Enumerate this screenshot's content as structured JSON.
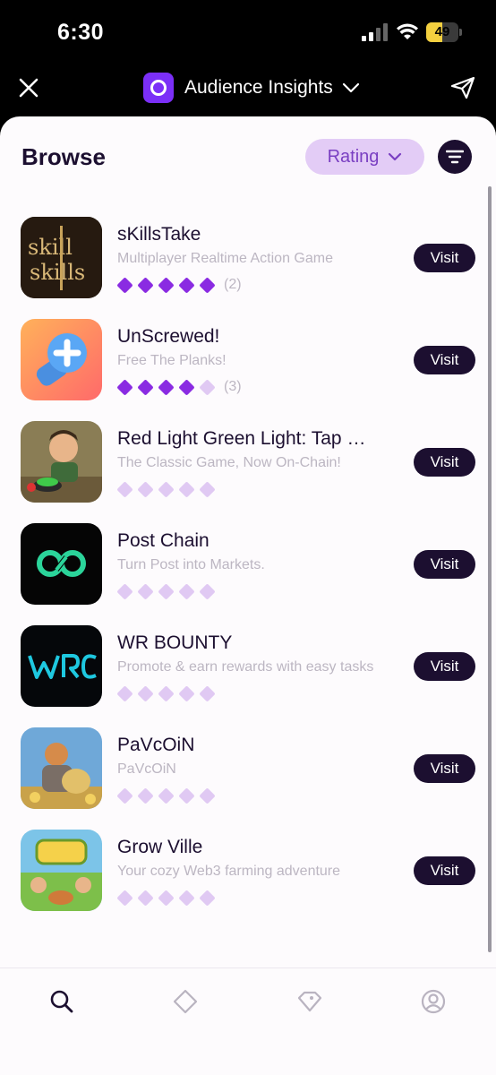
{
  "status_bar": {
    "time": "6:30",
    "battery": "49",
    "battery_level": 0.49
  },
  "header": {
    "title": "Audience Insights"
  },
  "browse": {
    "title": "Browse",
    "sort_label": "Rating"
  },
  "items": [
    {
      "name": "sKillsTake",
      "description": "Multiplayer Realtime Action Game",
      "rating": 5,
      "reviews": "(2)",
      "visit_label": "Visit"
    },
    {
      "name": "UnScrewed!",
      "description": "Free The Planks!",
      "rating": 4,
      "reviews": "(3)",
      "visit_label": "Visit"
    },
    {
      "name": "Red Light Green Light: Tap …",
      "description": "The Classic Game, Now On-Chain!",
      "rating": 0,
      "reviews": "",
      "visit_label": "Visit"
    },
    {
      "name": "Post Chain",
      "description": "Turn Post into Markets.",
      "rating": 0,
      "reviews": "",
      "visit_label": "Visit"
    },
    {
      "name": "WR BOUNTY",
      "description": "Promote & earn rewards with easy tasks",
      "rating": 0,
      "reviews": "",
      "visit_label": "Visit"
    },
    {
      "name": "PaVcOiN",
      "description": "PaVcOiN",
      "rating": 0,
      "reviews": "",
      "visit_label": "Visit"
    },
    {
      "name": "Grow Ville",
      "description": "Your cozy Web3 farming adventure",
      "rating": 0,
      "reviews": "",
      "visit_label": "Visit"
    }
  ],
  "icons": {
    "app_icons": [
      "skillstake-icon",
      "unscrewed-icon",
      "red-light-green-light-icon",
      "post-chain-icon",
      "wr-bounty-icon",
      "pavcoin-icon",
      "grow-ville-icon"
    ],
    "nav": [
      "search-icon",
      "diamond-icon",
      "tag-icon",
      "profile-icon"
    ]
  },
  "colors": {
    "accent": "#8a2be2",
    "accent_light": "#e0c9f3",
    "dark": "#1c0f30",
    "pill_bg": "#e3ccf6"
  }
}
